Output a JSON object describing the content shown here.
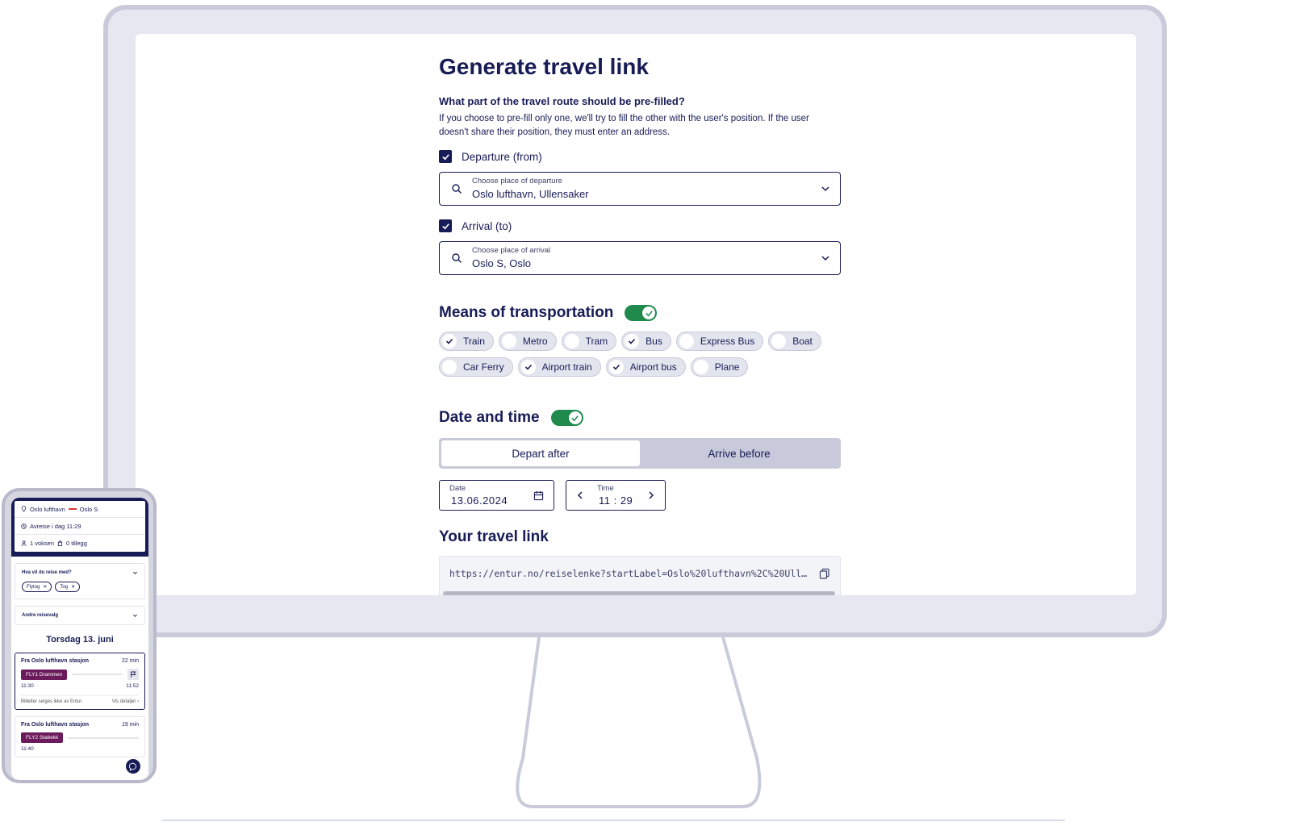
{
  "form": {
    "title": "Generate travel link",
    "question": "What part of the travel route should be pre-filled?",
    "help_text": "If you choose to pre-fill only one, we'll try to fill the other with the user's position. If the user doesn't share their position, they must enter an address.",
    "departure": {
      "checkbox_label": "Departure (from)",
      "checked": true,
      "field_label": "Choose place of departure",
      "value": "Oslo lufthavn, Ullensaker"
    },
    "arrival": {
      "checkbox_label": "Arrival (to)",
      "checked": true,
      "field_label": "Choose place of arrival",
      "value": "Oslo S, Oslo"
    },
    "transport": {
      "heading": "Means of transportation",
      "toggle_on": true,
      "modes": [
        {
          "label": "Train",
          "checked": true
        },
        {
          "label": "Metro",
          "checked": false
        },
        {
          "label": "Tram",
          "checked": false
        },
        {
          "label": "Bus",
          "checked": true
        },
        {
          "label": "Express Bus",
          "checked": false
        },
        {
          "label": "Boat",
          "checked": false
        },
        {
          "label": "Car Ferry",
          "checked": false
        },
        {
          "label": "Airport train",
          "checked": true
        },
        {
          "label": "Airport bus",
          "checked": true
        },
        {
          "label": "Plane",
          "checked": false
        }
      ]
    },
    "datetime": {
      "heading": "Date and time",
      "toggle_on": true,
      "tabs": [
        "Depart after",
        "Arrive before"
      ],
      "active_tab": "Depart after",
      "date_label": "Date",
      "date_value": "13.06.2024",
      "time_label": "Time",
      "time_value": "11 : 29"
    },
    "link": {
      "heading": "Your travel link",
      "url": "https://entur.no/reiselenke?startLabel=Oslo%20lufthavn%2C%20Ullen…"
    }
  },
  "phone": {
    "route_from": "Oslo lufthavn",
    "route_to": "Oslo S",
    "departure": "Avreise i dag 11:29",
    "travellers": "1 voksen",
    "extras": "0 tillegg",
    "filter_heading": "Hva vil du reise med?",
    "filter_tags": [
      "Flytog",
      "Tog"
    ],
    "other_heading": "Andre reisevalg",
    "day": "Torsdag 13. juni",
    "trips": [
      {
        "from": "Fra Oslo lufthavn stasjon",
        "duration": "22 min",
        "line": "FLY1 Drammen",
        "dep": "11:30",
        "arr": "11:52",
        "note": "Billetter selges ikke av Entur",
        "details": "Vis detaljer"
      },
      {
        "from": "Fra Oslo lufthavn stasjon",
        "duration": "19 min",
        "line": "FLY2 Stabekk",
        "dep": "11:40"
      }
    ]
  },
  "colors": {
    "primary": "#181c56",
    "toggle_green": "#1f8a4c",
    "chip_bg": "#e3e5ee",
    "badge_purple": "#6b1a5c"
  }
}
